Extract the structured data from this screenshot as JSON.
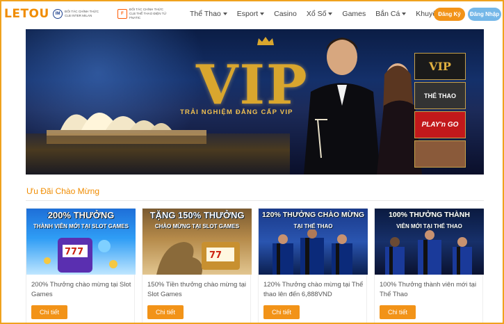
{
  "header": {
    "logo": "LETOU",
    "partners": [
      {
        "icon": "inter-milan-badge-icon",
        "line1": "ĐỐI TÁC CHÍNH THỨC",
        "line2": "CLB INTER MILAN"
      },
      {
        "icon": "fnatic-badge-icon",
        "line1": "ĐỐI TÁC CHÍNH THỨC",
        "line2": "CLB THỂ THAO ĐIỆN TỬ FNATIC"
      }
    ],
    "nav": [
      {
        "label": "Thể Thao",
        "dropdown": true
      },
      {
        "label": "Esport",
        "dropdown": true
      },
      {
        "label": "Casino",
        "dropdown": false
      },
      {
        "label": "Xổ Số",
        "dropdown": true
      },
      {
        "label": "Games",
        "dropdown": false
      },
      {
        "label": "Bắn Cá",
        "dropdown": true
      },
      {
        "label": "Khuyến Mãi",
        "dropdown": true
      }
    ],
    "register_label": "Đăng Ký",
    "login_label": "Đăng Nhập",
    "colors": {
      "brand": "#f08c00",
      "register": "#f29318",
      "login": "#74b7e8"
    }
  },
  "banner": {
    "title": "VIP",
    "subtitle": "TRẢI NGHIỆM ĐẲNG CẤP VIP",
    "thumbnails": [
      {
        "label": "VIP",
        "caption": "TRẢI NGHIỆM ĐẲNG CẤP VIP"
      },
      {
        "label": "THỂ THAO",
        "caption": ""
      },
      {
        "label": "PLAY'n GO",
        "caption": ""
      },
      {
        "label": "",
        "caption": ""
      }
    ]
  },
  "section": {
    "title": "Ưu Đãi Chào Mừng"
  },
  "cards": [
    {
      "headline": "200% THƯỞNG",
      "subline": "THÀNH VIÊN MỚI TẠI SLOT GAMES",
      "text": "200% Thưởng chào mừng tại Slot Games",
      "button": "Chi tiết"
    },
    {
      "headline": "TẶNG 150% THƯỞNG",
      "subline": "CHÀO MỪNG TẠI SLOT GAMES",
      "text": "150% Tiền thưởng chào mừng tại Slot Games",
      "button": "Chi tiết"
    },
    {
      "headline": "120% THƯỞNG CHÀO MỪNG",
      "subline": "TẠI THỂ THAO",
      "text": "120% Thưởng chào mừng tại Thể thao lên đến 6,888VND",
      "button": "Chi tiết"
    },
    {
      "headline": "100% THƯỞNG THÀNH",
      "subline": "VIÊN MỚI TẠI THỂ THAO",
      "text": "100% Thưởng thành viên mới tại Thể Thao",
      "button": "Chi tiết"
    }
  ]
}
